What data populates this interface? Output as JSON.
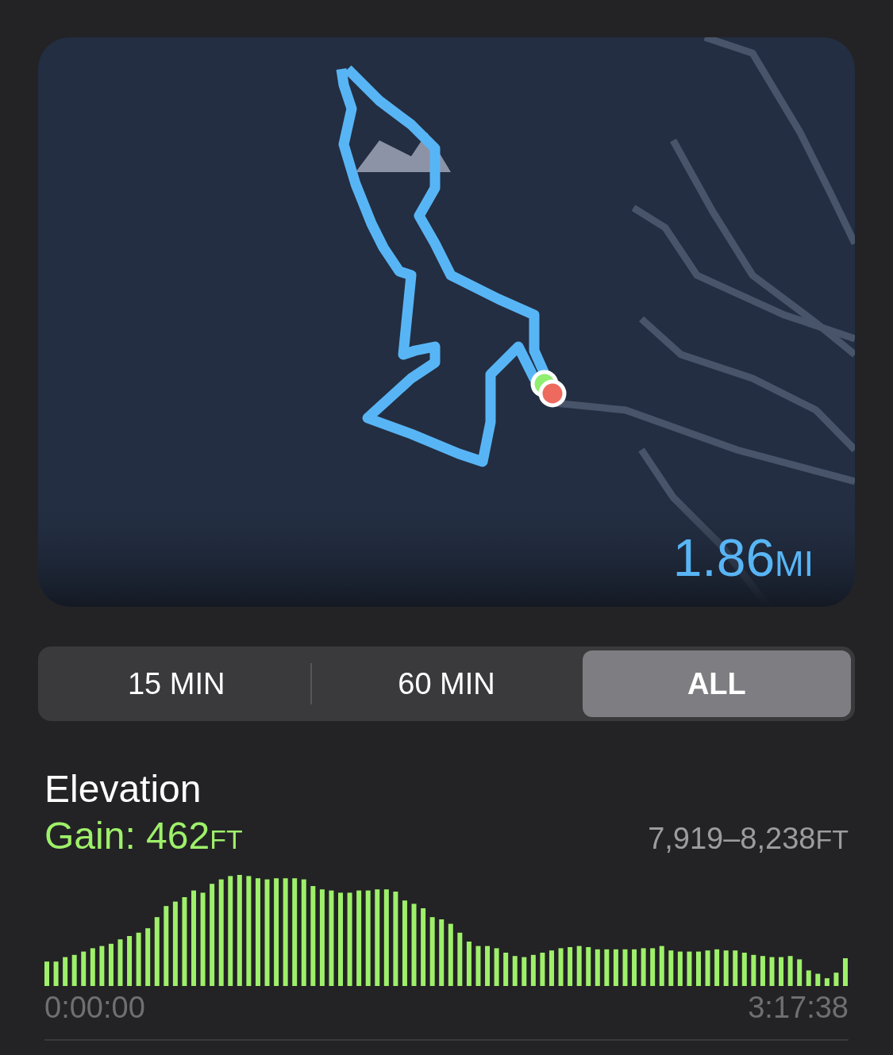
{
  "map": {
    "kind": "picture",
    "distance": {
      "value": "1.86",
      "unit": "MI"
    }
  },
  "segments": [
    {
      "label": "15 MIN",
      "selected": false
    },
    {
      "label": "60 MIN",
      "selected": false
    },
    {
      "label": "ALL",
      "selected": true
    }
  ],
  "elevation": {
    "title": "Elevation",
    "gain": {
      "label": "Gain: 462",
      "unit": "FT"
    },
    "range": {
      "value": "7,919–8,238",
      "unit": "FT"
    },
    "start_time": "0:00:00",
    "end_time": "3:17:38"
  }
}
